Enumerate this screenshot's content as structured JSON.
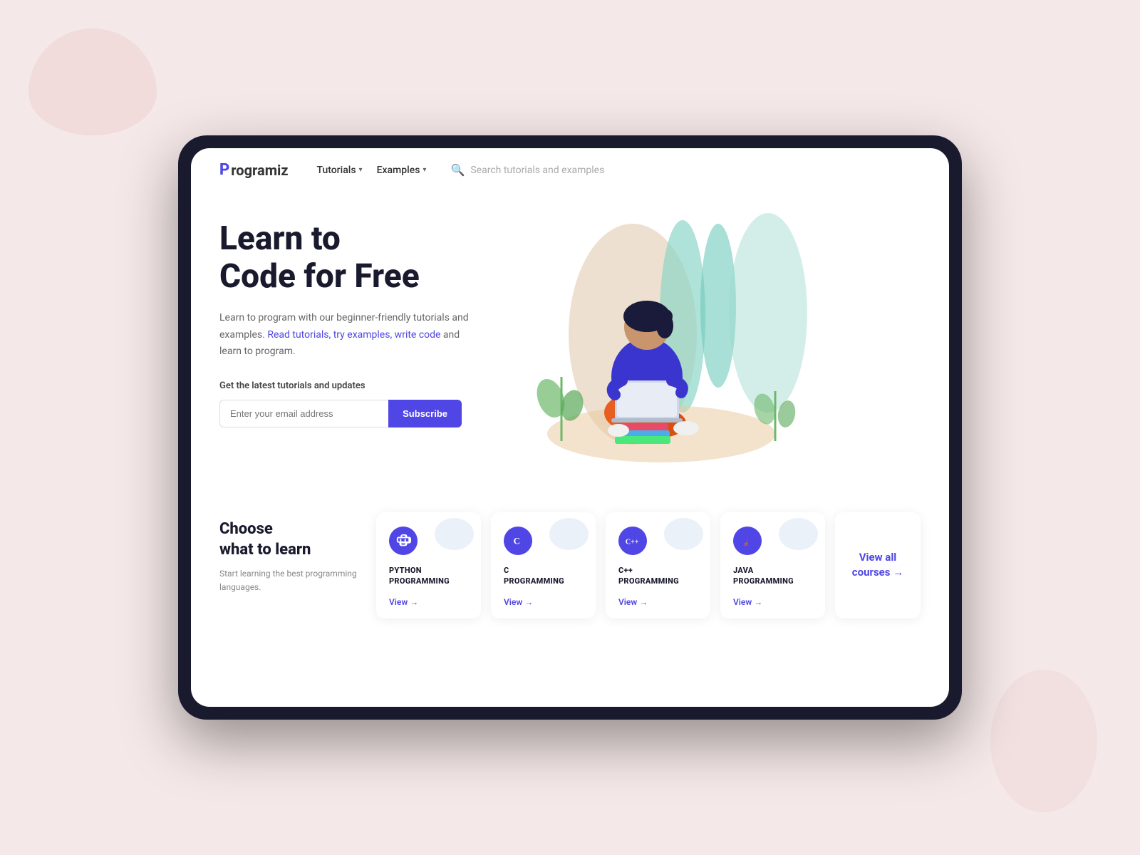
{
  "background": {
    "color": "#f5e8e8"
  },
  "nav": {
    "logo_text": "rogramiz",
    "logo_p": "P",
    "tutorials_label": "Tutorials",
    "examples_label": "Examples",
    "search_placeholder": "Search tutorials and examples"
  },
  "hero": {
    "title_line1": "Learn to",
    "title_line2": "Code for Free",
    "description_plain": "Learn to program with our beginner-friendly tutorials and examples. ",
    "description_link": "Read tutorials, try examples, write code",
    "description_end": " and learn to program.",
    "subscribe_label": "Get the latest tutorials and updates",
    "email_placeholder": "Enter your email address",
    "subscribe_btn": "Subscribe"
  },
  "courses": {
    "title_line1": "Choose",
    "title_line2": "what to learn",
    "description": "Start learning the best programming languages.",
    "cards": [
      {
        "name": "PYTHON\nPROGRAMMING",
        "view_text": "View →",
        "icon": "python"
      },
      {
        "name": "C\nPROGRAMMING",
        "view_text": "View →",
        "icon": "c"
      },
      {
        "name": "C++\nPROGRAMMING",
        "view_text": "View →",
        "icon": "cpp"
      },
      {
        "name": "JAVA\nPROGRAMMING",
        "view_text": "View →",
        "icon": "java"
      }
    ],
    "view_all_label": "View all\ncourses →"
  }
}
